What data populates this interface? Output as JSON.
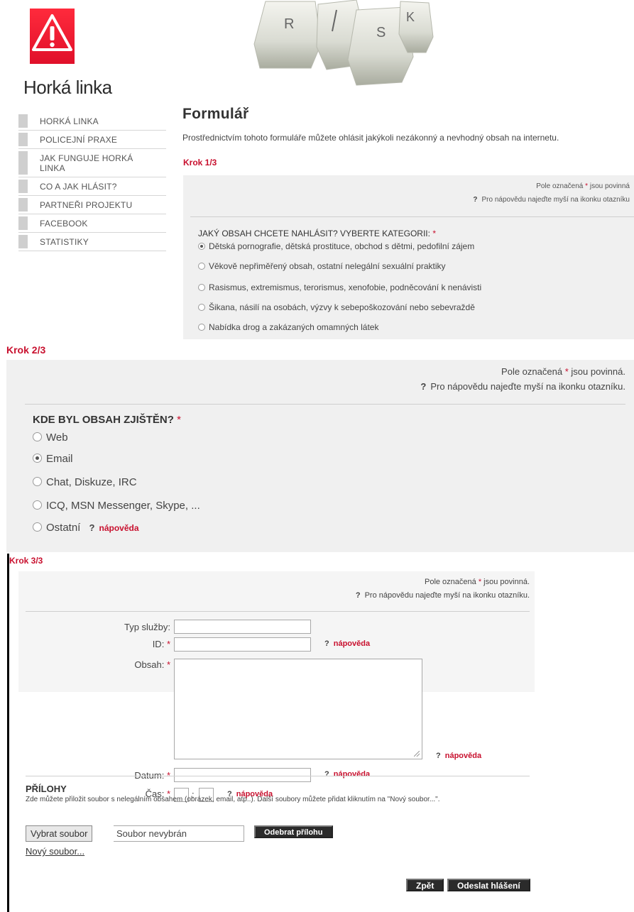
{
  "header": {
    "site_title": "Horká linka",
    "keys": [
      "R",
      "S",
      "K"
    ]
  },
  "nav": {
    "items": [
      "HORKÁ LINKA",
      "POLICEJNÍ PRAXE",
      "JAK FUNGUJE HORKÁ LINKA",
      "CO A JAK HLÁSIT?",
      "PARTNEŘI PROJEKTU",
      "FACEBOOK",
      "STATISTIKY"
    ]
  },
  "step1": {
    "title": "Formulář",
    "intro": "Prostřednictvím tohoto formuláře můžete ohlásit jakýkoli nezákonný a nevhodný obsah na internetu.",
    "step_label": "Krok 1/3",
    "required_prefix": "Pole označená",
    "required_suffix": "jsou povinná",
    "help_hint": "Pro nápovědu najeďte myší na ikonku otazníku",
    "question": "JAKÝ OBSAH CHCETE NAHLÁSIT? VYBERTE KATEGORII:",
    "options": [
      "Dětská pornografie, dětská prostituce, obchod s dětmi, pedofilní zájem",
      "Věkově nepřiměřený obsah, ostatní nelegální sexuální praktiky",
      "Rasismus, extremismus, terorismus, xenofobie, podněcování k nenávisti",
      "Šikana, násilí na osobách, výzvy k sebepoškozování nebo sebevraždě",
      "Nabídka drog a zakázaných omamných látek"
    ],
    "selected_index": 0
  },
  "step2": {
    "step_label": "Krok 2/3",
    "required_prefix": "Pole označená",
    "required_suffix": "jsou povinná.",
    "help_hint": "Pro nápovědu najeďte myší na ikonku otazníku.",
    "question": "KDE BYL OBSAH ZJIŠTĚN?",
    "options": [
      "Web",
      "Email",
      "Chat, Diskuze, IRC",
      "ICQ, MSN Messenger, Skype, ...",
      "Ostatní"
    ],
    "selected_index": 1,
    "help_link": "nápověda"
  },
  "step3": {
    "step_label": "Krok 3/3",
    "required_prefix": "Pole označená",
    "required_suffix": "jsou povinná.",
    "help_hint": "Pro nápovědu najeďte myší na ikonku otazníku.",
    "fields": {
      "service_type": {
        "label": "Typ služby:",
        "value": ""
      },
      "id": {
        "label": "ID:",
        "value": ""
      },
      "content": {
        "label": "Obsah:",
        "value": ""
      },
      "date": {
        "label": "Datum:",
        "value": ""
      },
      "time": {
        "label": "Čas:",
        "hours": "",
        "minutes": ""
      }
    },
    "help_link": "nápověda",
    "time_separator": ":",
    "attachments": {
      "title": "PŘÍLOHY",
      "description": "Zde můžete přiložit soubor s nelegálním obsahem (obrázek, email, atp..). Další soubory můžete přidat kliknutím na \"Nový soubor...\".",
      "choose_button": "Vybrat soubor",
      "file_status": "Soubor nevybrán",
      "remove_button": "Odebrat přílohu",
      "new_file_link": "Nový soubor..."
    },
    "back_button": "Zpět",
    "submit_button": "Odeslat hlášení"
  },
  "colors": {
    "accent_red": "#c8102e",
    "panel_gray": "#f0f0f0",
    "dark_button": "#2b2b2b"
  }
}
